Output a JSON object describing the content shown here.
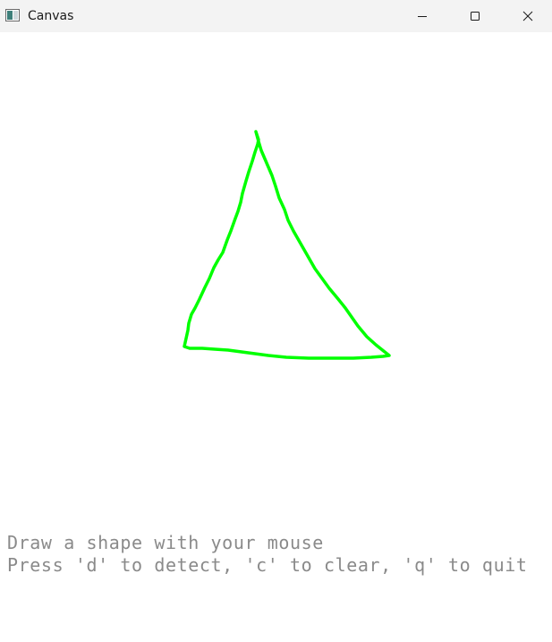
{
  "window": {
    "title": "Canvas",
    "app_icon": "window-app-icon",
    "controls": {
      "minimize_icon": "minimize-icon",
      "maximize_icon": "maximize-icon",
      "close_icon": "close-icon"
    }
  },
  "canvas": {
    "stroke_color": "#00ff00",
    "instructions": {
      "line1": "Draw a shape with your mouse",
      "line2": "Press 'd' to detect, 'c' to clear, 'q' to quit"
    },
    "text_color": "#8a8a8a"
  }
}
